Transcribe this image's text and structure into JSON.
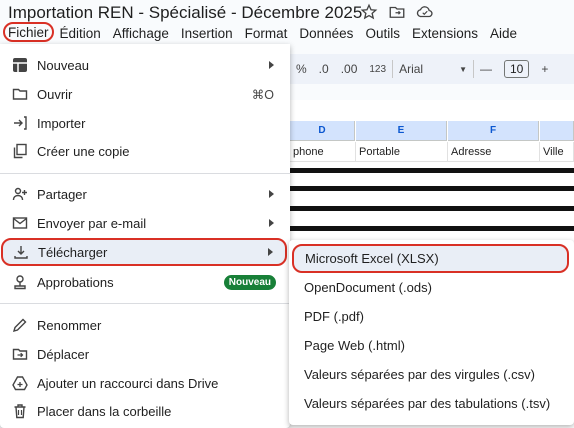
{
  "document": {
    "title": "Importation REN - Spécialisé - Décembre 2025"
  },
  "menubar": {
    "items": [
      "Fichier",
      "Édition",
      "Affichage",
      "Insertion",
      "Format",
      "Données",
      "Outils",
      "Extensions",
      "Aide"
    ]
  },
  "toolbar": {
    "percent": "%",
    "decimal_less": ".0",
    "decimal_more": ".00",
    "number_format": "123",
    "font": "Arial",
    "font_size": "10",
    "minus": "—",
    "plus": "+"
  },
  "sheet": {
    "columns": [
      "D",
      "E",
      "F"
    ],
    "header_row": [
      "phone",
      "Portable",
      "Adresse",
      "Ville"
    ]
  },
  "file_menu": {
    "items": [
      {
        "label": "Nouveau",
        "icon": "new-sheet-icon",
        "has_submenu": true
      },
      {
        "label": "Ouvrir",
        "icon": "folder-icon",
        "shortcut": "⌘O"
      },
      {
        "label": "Importer",
        "icon": "import-icon"
      },
      {
        "label": "Créer une copie",
        "icon": "copy-icon"
      },
      {
        "label": "Partager",
        "icon": "share-icon",
        "has_submenu": true
      },
      {
        "label": "Envoyer par e-mail",
        "icon": "email-icon",
        "has_submenu": true
      },
      {
        "label": "Télécharger",
        "icon": "download-icon",
        "has_submenu": true,
        "highlighted": true
      },
      {
        "label": "Approbations",
        "icon": "approvals-icon",
        "badge": "Nouveau"
      },
      {
        "label": "Renommer",
        "icon": "rename-icon"
      },
      {
        "label": "Déplacer",
        "icon": "move-icon"
      },
      {
        "label": "Ajouter un raccourci dans Drive",
        "icon": "drive-shortcut-icon"
      },
      {
        "label": "Placer dans la corbeille",
        "icon": "trash-icon"
      }
    ]
  },
  "download_submenu": {
    "items": [
      {
        "label": "Microsoft Excel (XLSX)",
        "highlighted": true
      },
      {
        "label": "OpenDocument (.ods)"
      },
      {
        "label": "PDF (.pdf)"
      },
      {
        "label": "Page Web (.html)"
      },
      {
        "label": "Valeurs séparées par des virgules (.csv)"
      },
      {
        "label": "Valeurs séparées par des tabulations (.tsv)"
      }
    ]
  },
  "colors": {
    "highlight_border": "#d93025",
    "badge_bg": "#188038",
    "column_header_bg": "#d3e3fd"
  }
}
